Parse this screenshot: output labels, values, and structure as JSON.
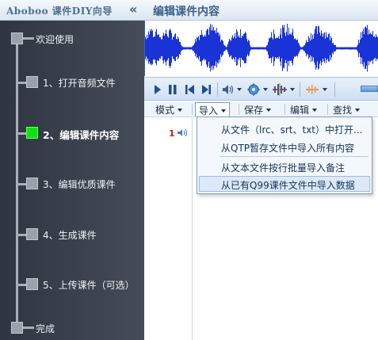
{
  "header": {
    "app_title": "Aboboo 课件DIY向导",
    "collapse_glyph": "«",
    "page_title": "编辑课件内容"
  },
  "sidebar": {
    "steps": [
      {
        "label": "欢迎使用",
        "active": false
      },
      {
        "label": "1、打开音频文件",
        "active": false
      },
      {
        "label": "2、编辑课件内容",
        "active": true
      },
      {
        "label": "3、编辑优质课件",
        "active": false
      },
      {
        "label": "4、生成课件",
        "active": false
      },
      {
        "label": "5、上传课件（可选）",
        "active": false
      },
      {
        "label": "完成",
        "active": false
      }
    ],
    "active_color": "#12e012"
  },
  "toolbar": {
    "icons": [
      "play-icon",
      "pause-icon",
      "skip-back-icon",
      "skip-forward-icon",
      "volume-icon",
      "settings-gear-icon",
      "waveform-split-icon",
      "marker-icon"
    ]
  },
  "menu": {
    "items": [
      "模式",
      "导入",
      "保存",
      "编辑",
      "查找"
    ],
    "open_item": "导入"
  },
  "import_menu": {
    "items": [
      "从文件（lrc、srt、txt）中打开...",
      "从QTP暂存文件中导入所有内容",
      "从文本文件按行批量导入备注",
      "从已有Q99课件文件中导入数据"
    ],
    "highlighted_index": 3
  },
  "content": {
    "row_number": "1"
  },
  "colors": {
    "waveform": "#1a33d6",
    "sidebar_bg": "#3b434f",
    "highlight": "#dde9f8",
    "row_number": "#d41c1c"
  }
}
